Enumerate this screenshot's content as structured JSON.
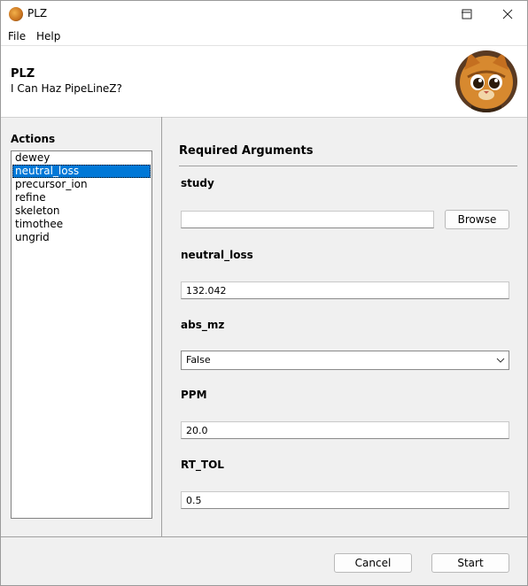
{
  "window": {
    "title": "PLZ",
    "minimize_glyph": "—",
    "maximize_glyph": "☐",
    "close_glyph": "✕"
  },
  "menu": [
    "File",
    "Help"
  ],
  "header": {
    "title": "PLZ",
    "subtitle": "I Can Haz PipeLineZ?"
  },
  "actions": {
    "label": "Actions",
    "items": [
      "dewey",
      "neutral_loss",
      "precursor_ion",
      "refine",
      "skeleton",
      "timothee",
      "ungrid"
    ],
    "selected": "neutral_loss"
  },
  "required": {
    "title": "Required Arguments",
    "study": {
      "label": "study",
      "value": "",
      "browse_label": "Browse"
    },
    "neutral_loss": {
      "label": "neutral_loss",
      "value": "132.042"
    },
    "abs_mz": {
      "label": "abs_mz",
      "value": "False"
    },
    "ppm": {
      "label": "PPM",
      "value": "20.0"
    },
    "rt_tol": {
      "label": "RT_TOL",
      "value": "0.5"
    }
  },
  "footer": {
    "cancel_label": "Cancel",
    "start_label": "Start"
  },
  "colors": {
    "selection": "#0078d7",
    "window_bg": "#f0f0f0"
  }
}
